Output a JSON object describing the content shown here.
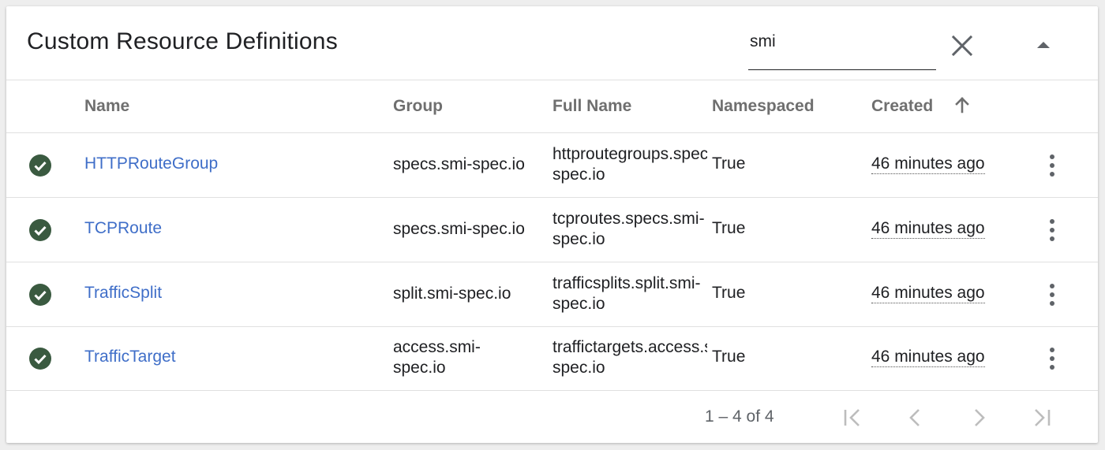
{
  "header": {
    "title": "Custom Resource Definitions",
    "search_value": "smi",
    "clear_icon": "close-icon",
    "collapse_icon": "arrow-drop-up-icon"
  },
  "columns": {
    "name": "Name",
    "group": "Group",
    "full_name": "Full Name",
    "namespaced": "Namespaced",
    "created": "Created",
    "sort_icon": "arrow-upward-icon"
  },
  "rows": [
    {
      "status_icon": "check-circle-icon",
      "name": "HTTPRouteGroup",
      "group": "specs.smi-spec.io",
      "full_name_line1": "httproutegroups.specs.smi-",
      "full_name_line2": "spec.io",
      "namespaced": "True",
      "created": "46 minutes ago"
    },
    {
      "status_icon": "check-circle-icon",
      "name": "TCPRoute",
      "group": "specs.smi-spec.io",
      "full_name_line1": "tcproutes.specs.smi-",
      "full_name_line2": "spec.io",
      "namespaced": "True",
      "created": "46 minutes ago"
    },
    {
      "status_icon": "check-circle-icon",
      "name": "TrafficSplit",
      "group": "split.smi-spec.io",
      "full_name_line1": "trafficsplits.split.smi-",
      "full_name_line2": "spec.io",
      "namespaced": "True",
      "created": "46 minutes ago"
    },
    {
      "status_icon": "check-circle-icon",
      "name": "TrafficTarget",
      "group_line1": "access.smi-",
      "group_line2": "spec.io",
      "full_name_line1": "traffictargets.access.smi-",
      "full_name_line2": "spec.io",
      "namespaced": "True",
      "created": "46 minutes ago"
    }
  ],
  "pagination": {
    "range": "1 – 4 of 4",
    "first_icon": "first-page-icon",
    "prev_icon": "chevron-left-icon",
    "next_icon": "chevron-right-icon",
    "last_icon": "last-page-icon"
  },
  "colors": {
    "link": "#3f6ec8",
    "status_ok": "#3a5a40",
    "header_text": "#6f6f6f"
  }
}
